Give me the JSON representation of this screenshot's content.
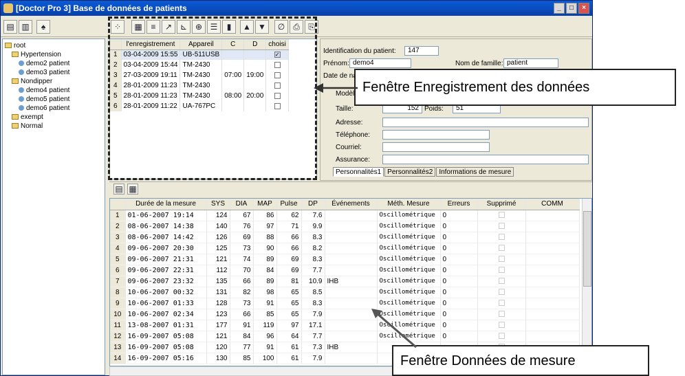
{
  "window": {
    "title": "[Doctor Pro 3] Base de données de patients"
  },
  "tree": {
    "items": [
      {
        "label": "root",
        "level": 0,
        "kind": "folder"
      },
      {
        "label": "Hypertension",
        "level": 1,
        "kind": "folder"
      },
      {
        "label": "demo2 patient",
        "level": 2,
        "kind": "patient"
      },
      {
        "label": "demo3 patient",
        "level": 2,
        "kind": "patient"
      },
      {
        "label": "Nondipper",
        "level": 1,
        "kind": "folder"
      },
      {
        "label": "demo4 patient",
        "level": 2,
        "kind": "patient"
      },
      {
        "label": "demo5 patient",
        "level": 2,
        "kind": "patient"
      },
      {
        "label": "demo6 patient",
        "level": 2,
        "kind": "patient"
      },
      {
        "label": "exempt",
        "level": 1,
        "kind": "folder"
      },
      {
        "label": "Normal",
        "level": 1,
        "kind": "folder"
      }
    ]
  },
  "records": {
    "headers": [
      "",
      "l'enregistrement",
      "Appareil",
      "C",
      "D",
      "choisi"
    ],
    "rows": [
      {
        "n": "1",
        "date": "03-04-2009 15:55",
        "device": "UB-511USB",
        "c": "",
        "d": "",
        "checked": true,
        "selected": true
      },
      {
        "n": "2",
        "date": "03-04-2009 15:44",
        "device": "TM-2430",
        "c": "",
        "d": "",
        "checked": false
      },
      {
        "n": "3",
        "date": "27-03-2009 19:11",
        "device": "TM-2430",
        "c": "07:00",
        "d": "19:00",
        "checked": false
      },
      {
        "n": "4",
        "date": "28-01-2009 11:23",
        "device": "TM-2430",
        "c": "",
        "d": "",
        "checked": false
      },
      {
        "n": "5",
        "date": "28-01-2009 11:23",
        "device": "TM-2430",
        "c": "08:00",
        "d": "20:00",
        "checked": false
      },
      {
        "n": "6",
        "date": "28-01-2009 11:22",
        "device": "UA-767PC",
        "c": "",
        "d": "",
        "checked": false
      }
    ]
  },
  "patient": {
    "id_label": "Identification du patient:",
    "id_value": "147",
    "firstname_label": "Prénom:",
    "firstname_value": "demo4",
    "lastname_label": "Nom de famille:",
    "lastname_value": "patient",
    "dob_label": "Date de nai",
    "model_label": "Modèle",
    "height_label": "Taille:",
    "height_value": "152",
    "weight_label": "Poids:",
    "weight_value": "51",
    "address_label": "Adresse:",
    "phone_label": "Téléphone:",
    "email_label": "Courriel:",
    "insurance_label": "Assurance:",
    "tabs": [
      "Personnalités1",
      "Personnalités2",
      "Informations de mesure"
    ]
  },
  "callouts": {
    "top": "Fenêtre Enregistrement des données",
    "bottom": "Fenêtre Données de mesure"
  },
  "measurements": {
    "headers": [
      "",
      "Durée de la mesure",
      "SYS",
      "DIA",
      "MAP",
      "Pulse",
      "DP",
      "Événements",
      "Méth. Mesure",
      "Erreurs",
      "Supprimé",
      "COMM"
    ],
    "rows": [
      {
        "n": "1",
        "date": "01-06-2007 19:14",
        "sys": "124",
        "dia": "67",
        "map": "86",
        "pulse": "62",
        "dp": "7.6",
        "event": "",
        "method": "Oscillométrique",
        "err": "0"
      },
      {
        "n": "2",
        "date": "08-06-2007 14:38",
        "sys": "140",
        "dia": "76",
        "map": "97",
        "pulse": "71",
        "dp": "9.9",
        "event": "",
        "method": "Oscillométrique",
        "err": "0"
      },
      {
        "n": "3",
        "date": "08-06-2007 14:42",
        "sys": "126",
        "dia": "69",
        "map": "88",
        "pulse": "66",
        "dp": "8.3",
        "event": "",
        "method": "Oscillométrique",
        "err": "0"
      },
      {
        "n": "4",
        "date": "09-06-2007 20:30",
        "sys": "125",
        "dia": "73",
        "map": "90",
        "pulse": "66",
        "dp": "8.2",
        "event": "",
        "method": "Oscillométrique",
        "err": "0"
      },
      {
        "n": "5",
        "date": "09-06-2007 21:31",
        "sys": "121",
        "dia": "74",
        "map": "89",
        "pulse": "69",
        "dp": "8.3",
        "event": "",
        "method": "Oscillométrique",
        "err": "0"
      },
      {
        "n": "6",
        "date": "09-06-2007 22:31",
        "sys": "112",
        "dia": "70",
        "map": "84",
        "pulse": "69",
        "dp": "7.7",
        "event": "",
        "method": "Oscillométrique",
        "err": "0"
      },
      {
        "n": "7",
        "date": "09-06-2007 23:32",
        "sys": "135",
        "dia": "66",
        "map": "89",
        "pulse": "81",
        "dp": "10.9",
        "event": "IHB",
        "method": "Oscillométrique",
        "err": "0"
      },
      {
        "n": "8",
        "date": "10-06-2007 00:32",
        "sys": "131",
        "dia": "82",
        "map": "98",
        "pulse": "65",
        "dp": "8.5",
        "event": "",
        "method": "Oscillométrique",
        "err": "0"
      },
      {
        "n": "9",
        "date": "10-06-2007 01:33",
        "sys": "128",
        "dia": "73",
        "map": "91",
        "pulse": "65",
        "dp": "8.3",
        "event": "",
        "method": "Oscillométrique",
        "err": "0"
      },
      {
        "n": "10",
        "date": "10-06-2007 02:34",
        "sys": "123",
        "dia": "66",
        "map": "85",
        "pulse": "65",
        "dp": "7.9",
        "event": "",
        "method": "Oscillométrique",
        "err": "0"
      },
      {
        "n": "11",
        "date": "13-08-2007 01:31",
        "sys": "177",
        "dia": "91",
        "map": "119",
        "pulse": "97",
        "dp": "17.1",
        "event": "",
        "method": "Oscillométrique",
        "err": "0"
      },
      {
        "n": "12",
        "date": "16-09-2007 05:08",
        "sys": "121",
        "dia": "84",
        "map": "96",
        "pulse": "64",
        "dp": "7.7",
        "event": "",
        "method": "Oscillométrique",
        "err": "0"
      },
      {
        "n": "13",
        "date": "16-09-2007 05:08",
        "sys": "120",
        "dia": "77",
        "map": "91",
        "pulse": "61",
        "dp": "7.3",
        "event": "IHB",
        "method": "",
        "err": ""
      },
      {
        "n": "14",
        "date": "16-09-2007 05:16",
        "sys": "130",
        "dia": "85",
        "map": "100",
        "pulse": "61",
        "dp": "7.9",
        "event": "",
        "method": "",
        "err": ""
      }
    ]
  }
}
